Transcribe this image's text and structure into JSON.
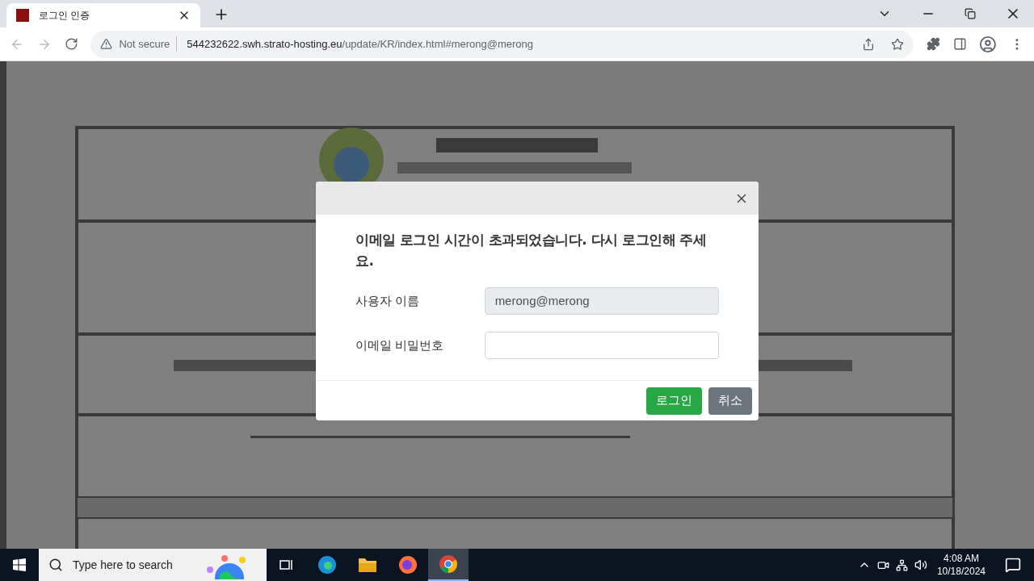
{
  "browser": {
    "tabs": [
      {
        "title": "로그인 인증",
        "selected": true
      }
    ],
    "address": {
      "security": "Not secure",
      "host": "544232622.swh.strato-hosting.eu",
      "path": "/update/KR/index.html#merong@merong"
    }
  },
  "dialog": {
    "message": "이메일 로그인 시간이 초과되었습니다. 다시 로그인해 주세요.",
    "fields": [
      {
        "label": "사용자 이름",
        "value": "merong@merong",
        "disabled": true
      },
      {
        "label": "이메일 비밀번호",
        "disabled": false
      }
    ],
    "buttons": [
      {
        "label": "로그인",
        "kind": "primary"
      },
      {
        "label": "취소",
        "kind": "secondary"
      }
    ]
  },
  "taskbar": {
    "search_placeholder": "Type here to search",
    "time": "4:08 AM",
    "date": "10/18/2024"
  }
}
